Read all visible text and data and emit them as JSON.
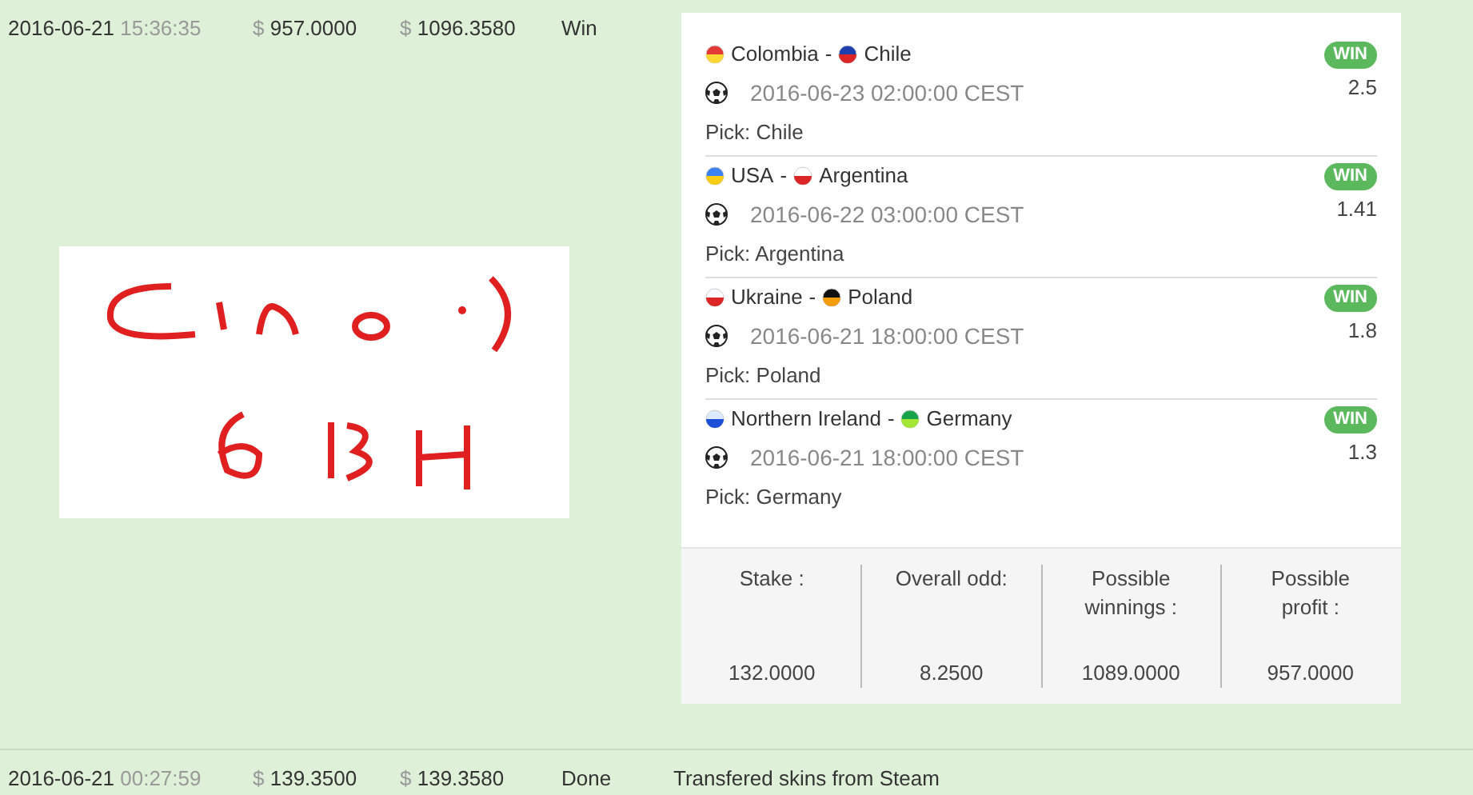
{
  "rows": [
    {
      "date": "2016-06-21",
      "time": "15:36:35",
      "currency_1": "$",
      "amount": "957.0000",
      "currency_2": "$",
      "balance": "1096.3580",
      "status": "Win",
      "expanded": true,
      "bets": [
        {
          "home": "Colombia",
          "separator": "-",
          "away": "Chile",
          "datetime": "2016-06-23 02:00:00 CEST",
          "pick": "Pick: Chile",
          "result": "WIN",
          "odd": "2.5"
        },
        {
          "home": "USA",
          "separator": "-",
          "away": "Argentina",
          "datetime": "2016-06-22 03:00:00 CEST",
          "pick": "Pick: Argentina",
          "result": "WIN",
          "odd": "1.41"
        },
        {
          "home": "Ukraine",
          "separator": "-",
          "away": "Poland",
          "datetime": "2016-06-21 18:00:00 CEST",
          "pick": "Pick: Poland",
          "result": "WIN",
          "odd": "1.8"
        },
        {
          "home": "Northern Ireland",
          "separator": "-",
          "away": "Germany",
          "datetime": "2016-06-21 18:00:00 CEST",
          "pick": "Pick: Germany",
          "result": "WIN",
          "odd": "1.3"
        }
      ],
      "summary": [
        {
          "label": "Stake :",
          "value": "132.0000"
        },
        {
          "label": "Overall odd:",
          "value": "8.2500"
        },
        {
          "label": "Possible winnings :",
          "value": "1089.0000"
        },
        {
          "label": "Possible profit :",
          "value": "957.0000"
        }
      ]
    },
    {
      "date": "2016-06-21",
      "time": "00:27:59",
      "currency_1": "$",
      "amount": "139.3500",
      "currency_2": "$",
      "balance": "139.3580",
      "status": "Done",
      "description": "Transfered skins from Steam",
      "expanded": false
    }
  ]
}
